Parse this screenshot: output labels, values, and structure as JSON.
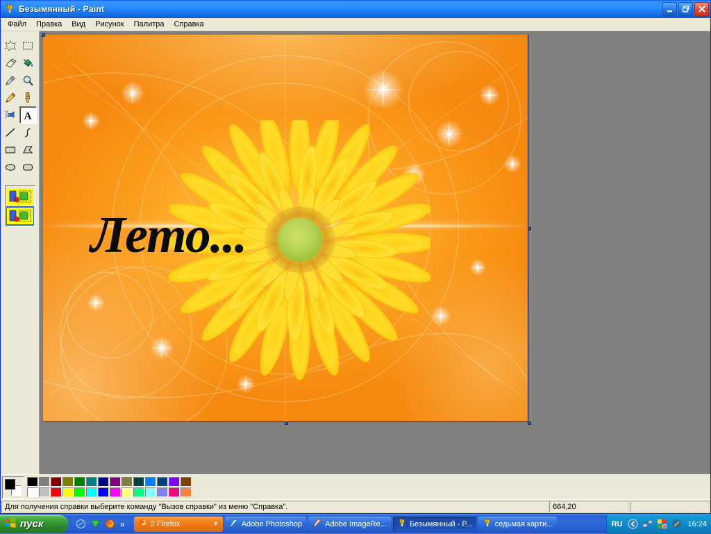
{
  "window": {
    "title": "Безымянный - Paint",
    "icon": "paint-icon",
    "minimize_label": "Свернуть",
    "maximize_label": "Развернуть",
    "close_label": "Закрыть"
  },
  "menu": {
    "items": [
      {
        "label": "Файл"
      },
      {
        "label": "Правка"
      },
      {
        "label": "Вид"
      },
      {
        "label": "Рисунок"
      },
      {
        "label": "Палитра"
      },
      {
        "label": "Справка"
      }
    ]
  },
  "toolbox": {
    "tools": [
      {
        "name": "free-form-select-tool",
        "label": "Выделение произвольной области",
        "selected": false
      },
      {
        "name": "select-tool",
        "label": "Выделение",
        "selected": false
      },
      {
        "name": "eraser-tool",
        "label": "Ластик",
        "selected": false
      },
      {
        "name": "fill-tool",
        "label": "Заливка",
        "selected": false
      },
      {
        "name": "pick-color-tool",
        "label": "Выбор цветов",
        "selected": false
      },
      {
        "name": "magnifier-tool",
        "label": "Масштаб",
        "selected": false
      },
      {
        "name": "pencil-tool",
        "label": "Карандаш",
        "selected": false
      },
      {
        "name": "brush-tool",
        "label": "Кисть",
        "selected": false
      },
      {
        "name": "airbrush-tool",
        "label": "Распылитель",
        "selected": false
      },
      {
        "name": "text-tool",
        "label": "Надпись",
        "selected": true
      },
      {
        "name": "line-tool",
        "label": "Линия",
        "selected": false
      },
      {
        "name": "curve-tool",
        "label": "Кривая",
        "selected": false
      },
      {
        "name": "rectangle-tool",
        "label": "Прямоугольник",
        "selected": false
      },
      {
        "name": "polygon-tool",
        "label": "Многоугольник",
        "selected": false
      },
      {
        "name": "ellipse-tool",
        "label": "Эллипс",
        "selected": false
      },
      {
        "name": "rounded-rectangle-tool",
        "label": "Скругленный прямоугольник",
        "selected": false
      }
    ],
    "options": [
      {
        "name": "opaque-background-option",
        "label": "Непрозрачный фон",
        "active": false
      },
      {
        "name": "transparent-background-option",
        "label": "Прозрачный фон",
        "active": true
      }
    ]
  },
  "canvas": {
    "text": "Лето...",
    "text_color": "#0a0a0a",
    "image_alt": "Жёлтый цветок на оранжевом фоне",
    "background_color": "#f7941e",
    "accent_color": "#ffb02e",
    "flower_center_color": "#b9d455",
    "selected": true
  },
  "palette": {
    "foreground": "#000000",
    "background": "#ffffff",
    "row1": [
      "#000000",
      "#808080",
      "#800000",
      "#808000",
      "#008000",
      "#008080",
      "#000080",
      "#800080",
      "#808040",
      "#004040",
      "#0080ff",
      "#004080",
      "#8000ff",
      "#804000"
    ],
    "row2": [
      "#ffffff",
      "#c0c0c0",
      "#ff0000",
      "#ffff00",
      "#00ff00",
      "#00ffff",
      "#0000ff",
      "#ff00ff",
      "#ffff80",
      "#00ff80",
      "#80ffff",
      "#8080ff",
      "#ff0080",
      "#ff8040"
    ]
  },
  "statusbar": {
    "help": "Для получения справки выберите команду \"Вызов справки\" из меню \"Справка\".",
    "coordinates": "664,20",
    "size": ""
  },
  "taskbar": {
    "start_label": "пуск",
    "quicklaunch": [
      {
        "name": "show-desktop-icon",
        "label": "Свернуть все окна"
      },
      {
        "name": "utorrent-icon",
        "label": "uTorrent"
      },
      {
        "name": "firefox-icon",
        "label": "Mozilla Firefox"
      }
    ],
    "quicklaunch_more": "»",
    "tasks": [
      {
        "name": "taskbar-item-firefox",
        "label": "2 Firefox",
        "icon": "firefox-icon",
        "group": true,
        "active": false
      },
      {
        "name": "taskbar-item-photoshop",
        "label": "Adobe Photoshop",
        "icon": "photoshop-icon",
        "group": false,
        "active": false
      },
      {
        "name": "taskbar-item-imageready",
        "label": "Adobe ImageRe...",
        "icon": "imageready-icon",
        "group": false,
        "active": false
      },
      {
        "name": "taskbar-item-paint",
        "label": "Безымянный - Р...",
        "icon": "paint-icon",
        "group": false,
        "active": true
      },
      {
        "name": "taskbar-item-picture",
        "label": "седьмая карти...",
        "icon": "paint-icon",
        "group": false,
        "active": false
      }
    ],
    "tray": {
      "language": "RU",
      "icons": [
        {
          "name": "show-hidden-icons-icon",
          "label": "Отображать скрытые значки"
        },
        {
          "name": "network-icon",
          "label": "Сетевые подключения"
        },
        {
          "name": "antivirus-icon",
          "label": "Антивирус"
        },
        {
          "name": "pen-tablet-icon",
          "label": "Перо"
        }
      ],
      "clock": "16:24"
    }
  }
}
